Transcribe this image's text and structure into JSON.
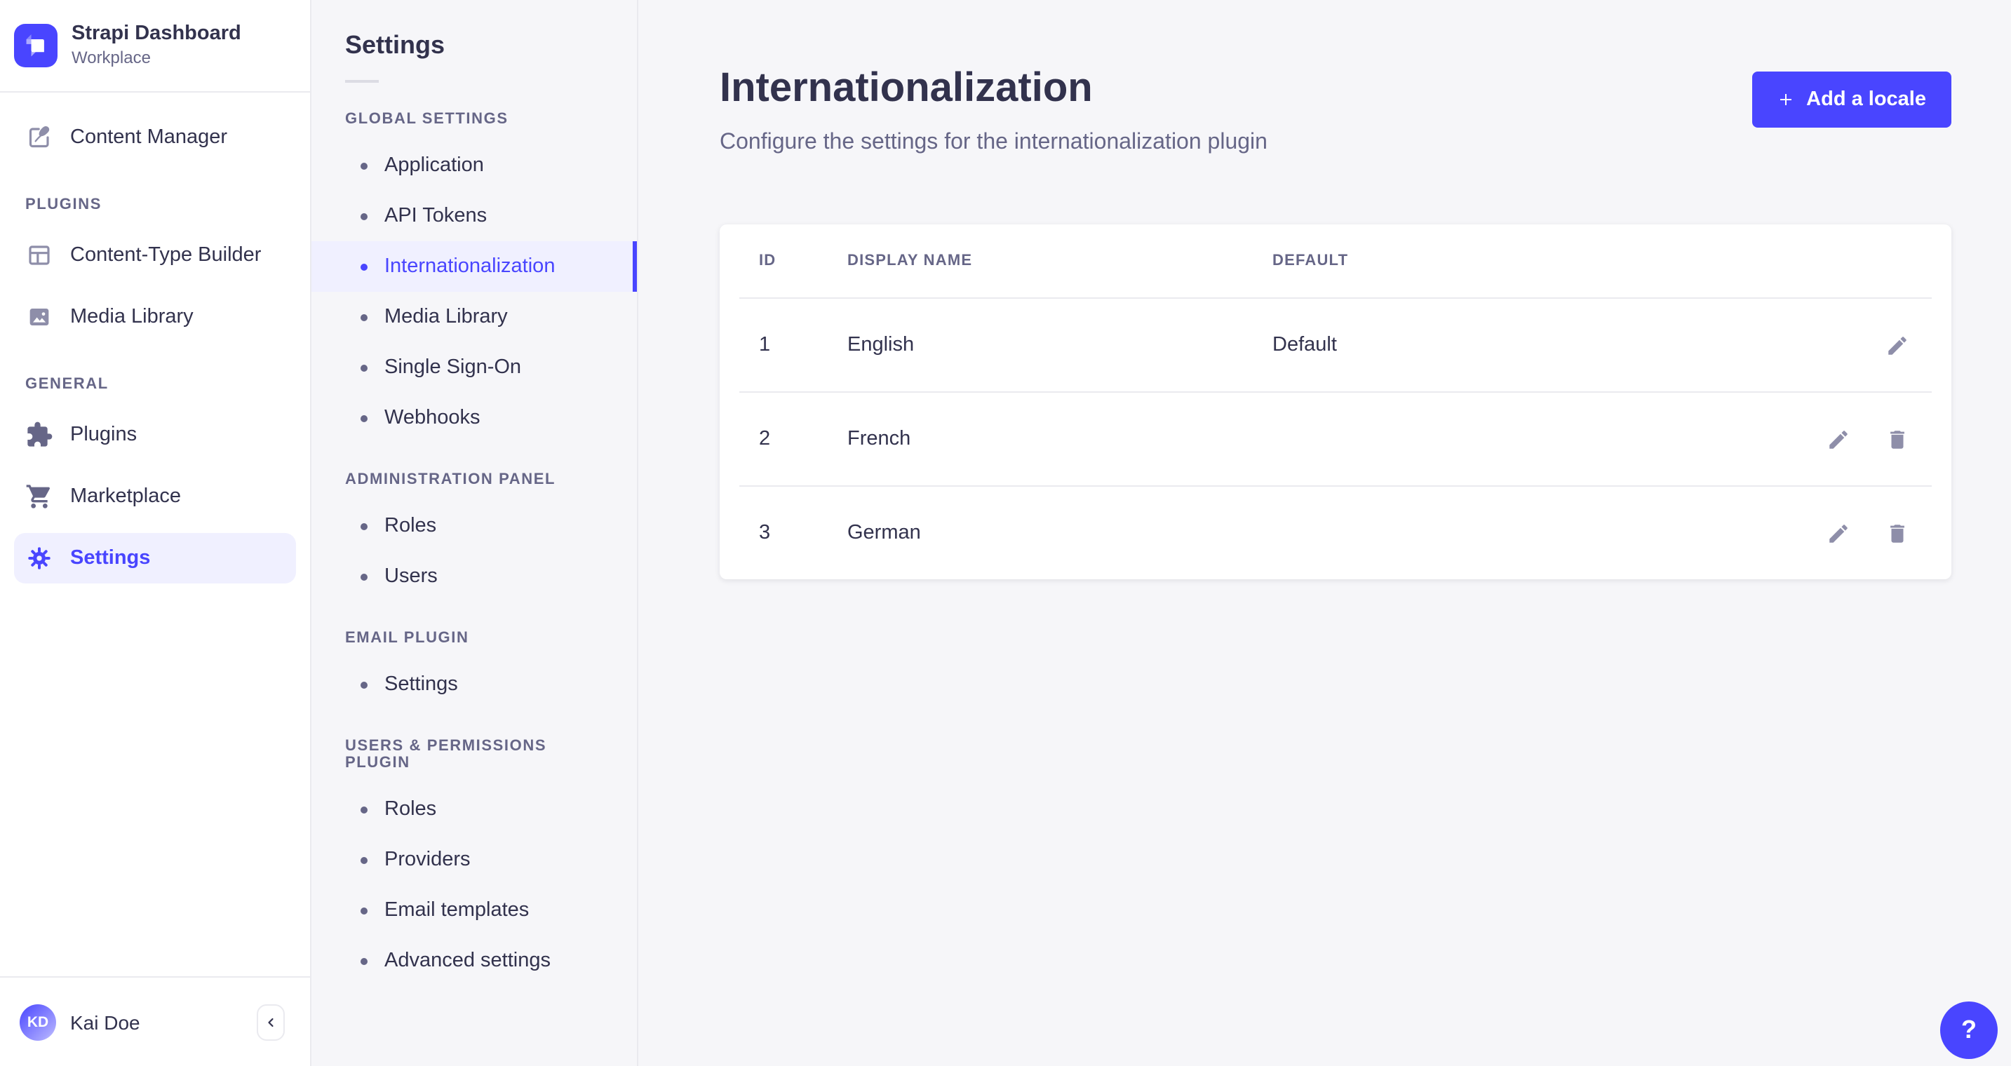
{
  "colors": {
    "accent": "#4945ff",
    "accent_bg": "#f0f0ff",
    "text": "#32324d",
    "text_muted": "#666687",
    "icon_gray": "#8e8ea9",
    "border": "#eaeaef",
    "page_bg": "#f6f6f9"
  },
  "brand": {
    "title": "Strapi Dashboard",
    "subtitle": "Workplace",
    "logo_icon": "strapi-logo-icon"
  },
  "sidebar": {
    "active_item": "Settings",
    "top_items": [
      {
        "label": "Content Manager",
        "icon": "content-manager-icon"
      }
    ],
    "sections": [
      {
        "label": "PLUGINS",
        "items": [
          {
            "label": "Content-Type Builder",
            "icon": "content-type-builder-icon"
          },
          {
            "label": "Media Library",
            "icon": "media-library-icon"
          }
        ]
      },
      {
        "label": "GENERAL",
        "items": [
          {
            "label": "Plugins",
            "icon": "puzzle-icon"
          },
          {
            "label": "Marketplace",
            "icon": "cart-icon"
          },
          {
            "label": "Settings",
            "icon": "gear-icon",
            "active": true
          }
        ]
      }
    ],
    "user": {
      "initials": "KD",
      "name": "Kai Doe"
    },
    "collapse_icon": "chevron-left-icon"
  },
  "subnav": {
    "title": "Settings",
    "active_item": "Internationalization",
    "sections": [
      {
        "label": "GLOBAL SETTINGS",
        "items": [
          {
            "label": "Application"
          },
          {
            "label": "API Tokens"
          },
          {
            "label": "Internationalization",
            "active": true
          },
          {
            "label": "Media Library"
          },
          {
            "label": "Single Sign-On"
          },
          {
            "label": "Webhooks"
          }
        ]
      },
      {
        "label": "ADMINISTRATION PANEL",
        "items": [
          {
            "label": "Roles"
          },
          {
            "label": "Users"
          }
        ]
      },
      {
        "label": "EMAIL PLUGIN",
        "items": [
          {
            "label": "Settings"
          }
        ]
      },
      {
        "label": "USERS & PERMISSIONS PLUGIN",
        "items": [
          {
            "label": "Roles"
          },
          {
            "label": "Providers"
          },
          {
            "label": "Email templates"
          },
          {
            "label": "Advanced settings"
          }
        ]
      }
    ]
  },
  "main": {
    "title": "Internationalization",
    "subtitle": "Configure the settings for the internationalization plugin",
    "add_locale_button": "Add a locale",
    "table": {
      "headers": {
        "id": "ID",
        "display_name": "DISPLAY NAME",
        "default": "DEFAULT"
      },
      "rows": [
        {
          "id": "1",
          "display_name": "English",
          "default": "Default",
          "actions": [
            "edit"
          ]
        },
        {
          "id": "2",
          "display_name": "French",
          "default": "",
          "actions": [
            "edit",
            "delete"
          ]
        },
        {
          "id": "3",
          "display_name": "German",
          "default": "",
          "actions": [
            "edit",
            "delete"
          ]
        }
      ]
    },
    "help_button": "?"
  }
}
